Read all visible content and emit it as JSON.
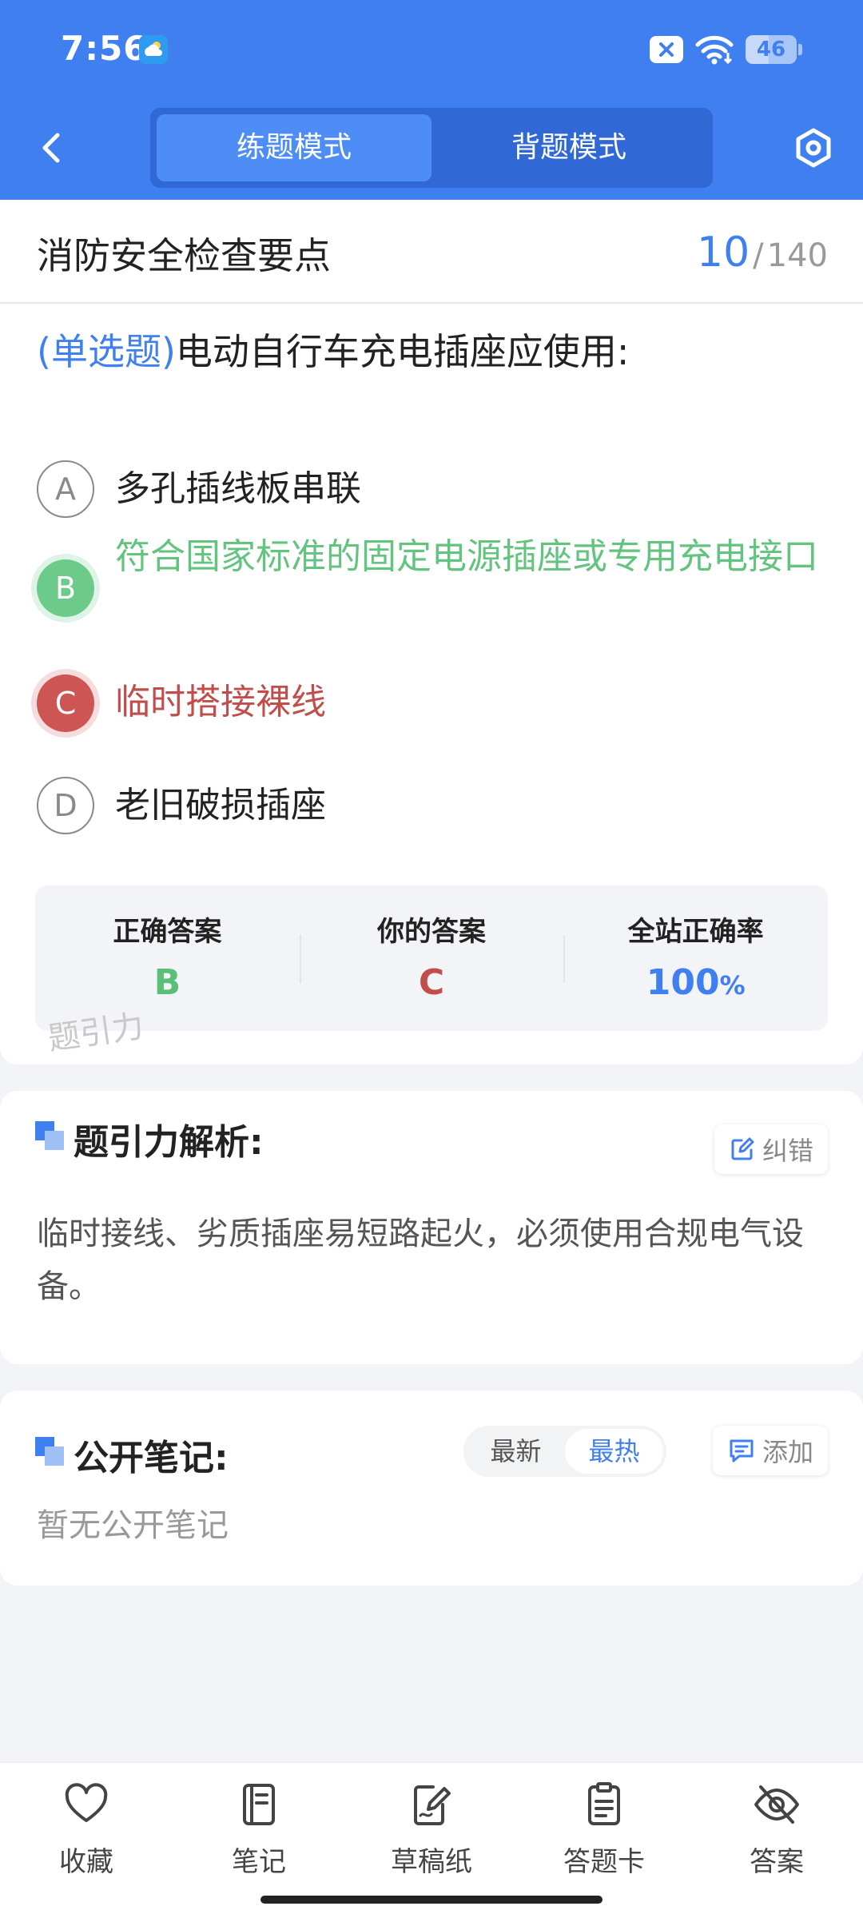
{
  "status_bar": {
    "time": "7:56",
    "battery": "46"
  },
  "header": {
    "mode_tabs": [
      {
        "label": "练题模式",
        "active": true
      },
      {
        "label": "背题模式",
        "active": false
      }
    ]
  },
  "question_header": {
    "chapter": "消防安全检查要点",
    "current": "10",
    "separator": "/",
    "total": "140"
  },
  "question": {
    "type": "(单选题)",
    "text": "电动自行车充电插座应使用:",
    "options": [
      {
        "letter": "A",
        "text": "多孔插线板串联",
        "state": "normal"
      },
      {
        "letter": "B",
        "text": "符合国家标准的固定电源插座或专用充电接口",
        "state": "correct"
      },
      {
        "letter": "C",
        "text": "临时搭接裸线",
        "state": "wrong"
      },
      {
        "letter": "D",
        "text": "老旧破损插座",
        "state": "normal"
      }
    ]
  },
  "stats": {
    "correct_label": "正确答案",
    "correct_value": "B",
    "yours_label": "你的答案",
    "yours_value": "C",
    "rate_label": "全站正确率",
    "rate_value": "100",
    "rate_unit": "%"
  },
  "watermark": "题引力",
  "analysis": {
    "title": "题引力解析:",
    "report_label": "纠错",
    "text": "临时接线、劣质插座易短路起火，必须使用合规电气设备。"
  },
  "notes": {
    "title": "公开笔记:",
    "sort_options": [
      {
        "label": "最新",
        "active": false
      },
      {
        "label": "最热",
        "active": true
      }
    ],
    "add_label": "添加",
    "empty_text": "暂无公开笔记"
  },
  "bottom_nav": {
    "items": [
      {
        "label": "收藏",
        "icon": "heart-icon"
      },
      {
        "label": "笔记",
        "icon": "notebook-icon"
      },
      {
        "label": "草稿纸",
        "icon": "draft-icon"
      },
      {
        "label": "答题卡",
        "icon": "clipboard-icon"
      },
      {
        "label": "答案",
        "icon": "eye-off-icon"
      }
    ]
  },
  "colors": {
    "brand": "#3f7ff0",
    "correct": "#63c47f",
    "wrong": "#c24e4c"
  }
}
